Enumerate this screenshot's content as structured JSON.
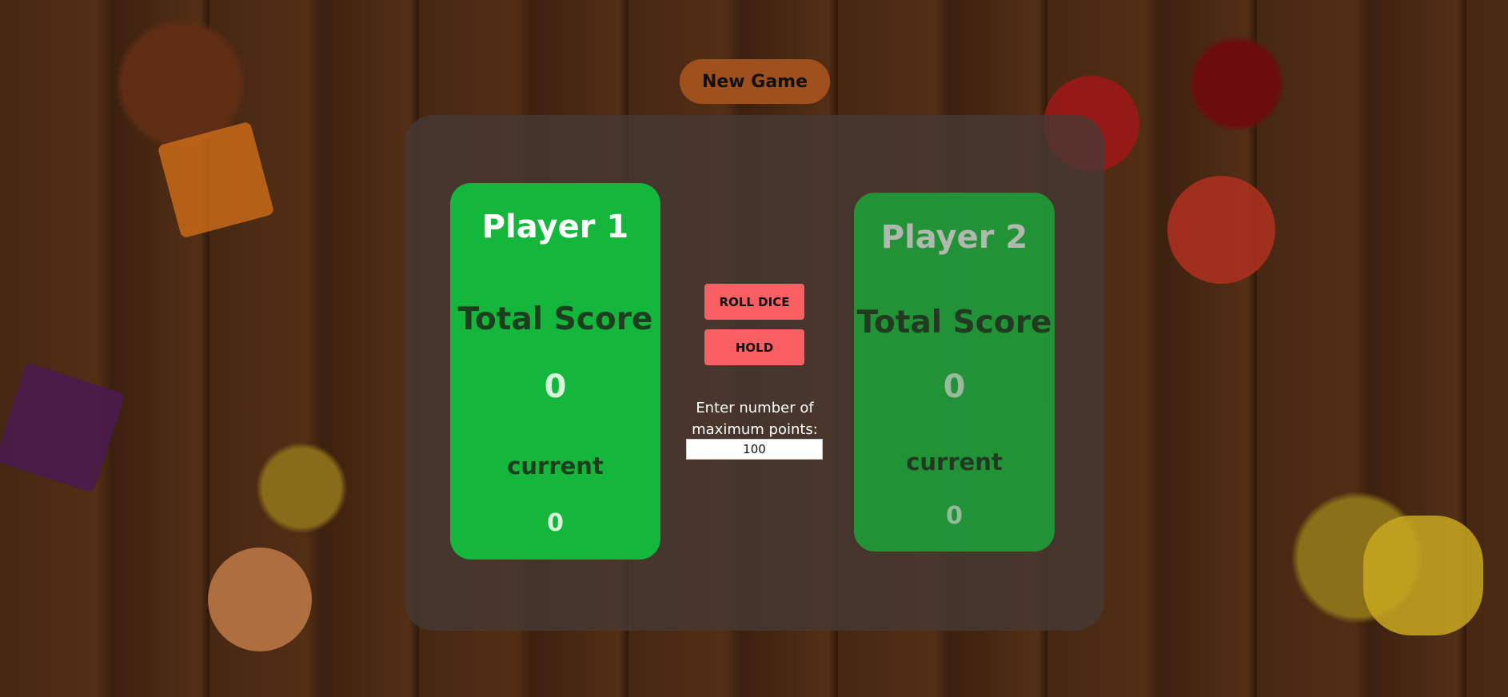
{
  "controls": {
    "new_game_label": "New Game",
    "roll_dice_label": "ROLL DICE",
    "hold_label": "HOLD",
    "max_points_label": "Enter number of maximum points:",
    "max_points_value": "100"
  },
  "players": [
    {
      "name": "Player 1",
      "total_label": "Total Score",
      "total_value": "0",
      "current_label": "current",
      "current_value": "0",
      "active": true
    },
    {
      "name": "Player 2",
      "total_label": "Total Score",
      "total_value": "0",
      "current_label": "current",
      "current_value": "0",
      "active": false
    }
  ],
  "colors": {
    "active_panel": "#14b63c",
    "inactive_panel": "#1f9a38",
    "action_button": "#f95f63",
    "new_game_button": "#a0501c"
  }
}
